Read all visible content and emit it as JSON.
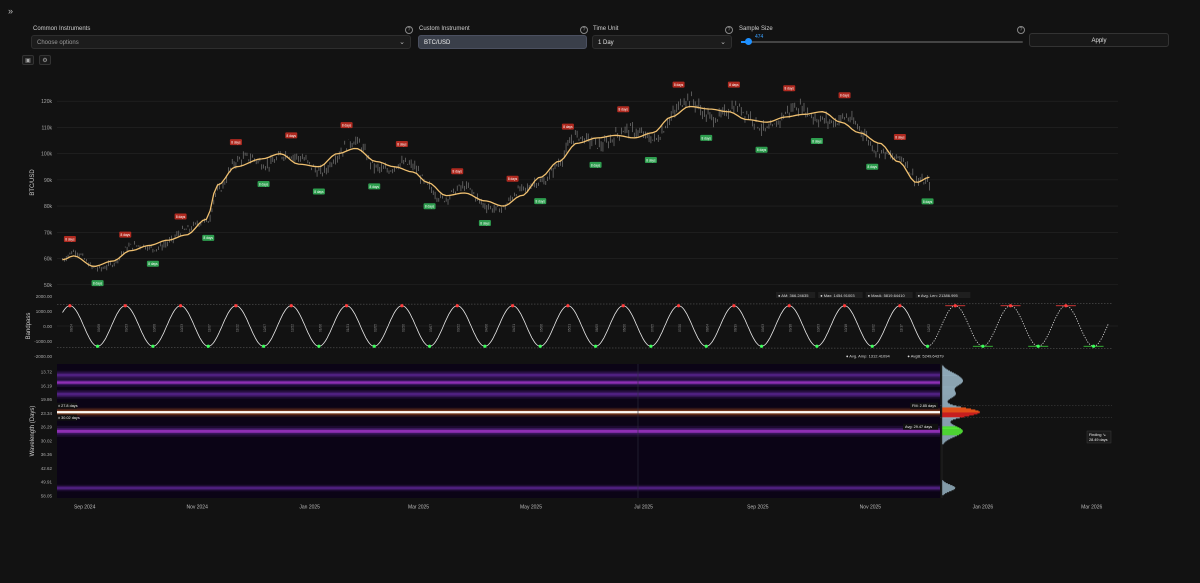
{
  "expand_label": "»",
  "controls": {
    "common": {
      "label": "Common Instruments",
      "placeholder": "Choose options"
    },
    "custom": {
      "label": "Custom Instrument",
      "value": "BTC/USD"
    },
    "time_unit": {
      "label": "Time Unit",
      "value": "1 Day"
    },
    "sample": {
      "label": "Sample Size",
      "value": "474",
      "fraction": 0.025
    },
    "apply_label": "Apply",
    "help_glyph": "?"
  },
  "colors": {
    "accent": "#1e90ff",
    "bull": "#2e9e4f",
    "bear": "#b02a20",
    "price_line": "#f0c070"
  },
  "chart_data": [
    {
      "type": "line",
      "name": "price",
      "ylabel": "BTC/USD",
      "ylim": [
        48000,
        130000
      ],
      "yticks": [
        50000,
        60000,
        70000,
        80000,
        90000,
        100000,
        110000,
        120000
      ],
      "ytick_labels": [
        "50k",
        "60k",
        "70k",
        "80k",
        "90k",
        "100k",
        "110k",
        "120k"
      ],
      "x": [
        "2024-08-20",
        "2024-08-26",
        "2024-09-06",
        "2024-09-16",
        "2024-09-26",
        "2024-10-06",
        "2024-10-16",
        "2024-10-26",
        "2024-11-06",
        "2024-11-12",
        "2024-11-22",
        "2024-12-06",
        "2024-12-16",
        "2024-12-26",
        "2025-01-06",
        "2025-01-16",
        "2025-01-26",
        "2025-02-06",
        "2025-02-16",
        "2025-02-26",
        "2025-03-06",
        "2025-03-16",
        "2025-03-26",
        "2025-04-06",
        "2025-04-16",
        "2025-04-26",
        "2025-05-06",
        "2025-05-16",
        "2025-05-26",
        "2025-06-06",
        "2025-06-16",
        "2025-06-26",
        "2025-07-06",
        "2025-07-16",
        "2025-07-26",
        "2025-08-06",
        "2025-08-16",
        "2025-08-26",
        "2025-09-06",
        "2025-09-16",
        "2025-09-26",
        "2025-10-06",
        "2025-10-16",
        "2025-10-26",
        "2025-11-06",
        "2025-11-16",
        "2025-11-26",
        "2025-12-03"
      ],
      "y": [
        59500,
        61000,
        57000,
        59000,
        63000,
        65000,
        67000,
        69000,
        75000,
        88000,
        95000,
        98000,
        100000,
        96000,
        95000,
        100000,
        102000,
        97000,
        95000,
        93000,
        89000,
        84000,
        85000,
        82000,
        80000,
        84000,
        91000,
        97000,
        104000,
        106000,
        107000,
        106000,
        108000,
        114000,
        118000,
        117000,
        116000,
        113000,
        112000,
        114000,
        115000,
        116000,
        112000,
        108000,
        104000,
        97000,
        89000,
        91000
      ],
      "cycle_markers": {
        "top_label": "8 days",
        "bottom_label": "8 days"
      }
    },
    {
      "type": "line",
      "name": "bandpass",
      "ylabel": "Bandpass",
      "ylim": [
        -2000,
        2000
      ],
      "yticks": [
        2000,
        1000,
        0,
        -1000,
        -2000
      ],
      "ytick_labels": [
        "2000.00",
        "1000.00",
        "0.00",
        "-1000.00",
        "-2000.00"
      ],
      "period_days": 30,
      "amplitude": 1350,
      "stats_top": [
        {
          "key": "AM:",
          "value": "366.24635"
        },
        {
          "key": "Max:",
          "value": "1454.91003"
        },
        {
          "key": "MaxA:",
          "value": "5819.64410"
        },
        {
          "key": "Avg. Len:",
          "value": "21386.995"
        }
      ],
      "stats_bottom": [
        {
          "key": "Avg. Amp:",
          "value": "1312.41094"
        },
        {
          "key": "AvgB:",
          "value": "5249.64379"
        }
      ]
    },
    {
      "type": "heatmap",
      "name": "wavelength",
      "ylabel": "Wavelength (Days)",
      "yticks": [
        "13.72",
        "16.19",
        "19.86",
        "23.34",
        "26.29",
        "30.02",
        "36.36",
        "42.62",
        "49.91",
        "58.05"
      ],
      "bands": [
        {
          "day": 29.9,
          "intensity": 1.0,
          "width": 4
        },
        {
          "day": 36.6,
          "intensity": 0.55,
          "width": 5
        },
        {
          "day": 19.5,
          "intensity": 0.45,
          "width": 4
        },
        {
          "day": 23.6,
          "intensity": 0.35,
          "width": 4
        },
        {
          "day": 16.9,
          "intensity": 0.3,
          "width": 4
        },
        {
          "day": 56.5,
          "intensity": 0.35,
          "width": 3
        }
      ],
      "markers": {
        "upper": "± 27.8 days",
        "lower": "± 30.02 days"
      },
      "annotations": {
        "fm": "FM: 2.85 days",
        "avg": "Avg: 29.47 days"
      },
      "finding": {
        "title": "Finding ↘",
        "value": "28.49 days"
      }
    }
  ],
  "x_axis": {
    "labels": [
      "Sep 2024",
      "Nov 2024",
      "Jan 2025",
      "Mar 2025",
      "May 2025",
      "Jul 2025",
      "Sep 2025",
      "Nov 2025",
      "Jan 2026",
      "Mar 2026"
    ],
    "dates": [
      "2024-09-01",
      "2024-11-01",
      "2025-01-01",
      "2025-03-01",
      "2025-05-01",
      "2025-07-01",
      "2025-09-01",
      "2025-11-01",
      "2026-01-01",
      "2026-03-01"
    ]
  }
}
